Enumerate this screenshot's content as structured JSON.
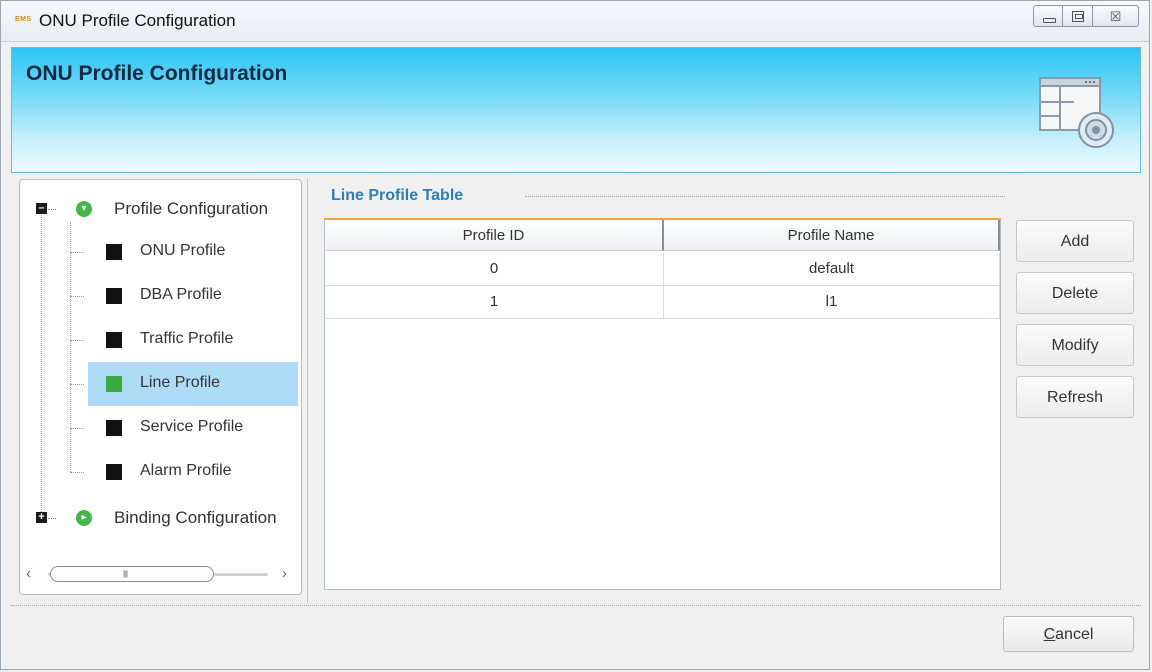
{
  "window": {
    "app_icon_text": "EMS",
    "title": "ONU Profile Configuration",
    "controls": {
      "minimize": "minimize",
      "maximize": "maximize",
      "close": "close"
    }
  },
  "banner": {
    "title": "ONU Profile Configuration"
  },
  "tree": {
    "groups": [
      {
        "label": "Profile Configuration",
        "expanded": true,
        "children": [
          {
            "label": "ONU Profile",
            "selected": false
          },
          {
            "label": "DBA Profile",
            "selected": false
          },
          {
            "label": "Traffic Profile",
            "selected": false
          },
          {
            "label": "Line Profile",
            "selected": true
          },
          {
            "label": "Service Profile",
            "selected": false
          },
          {
            "label": "Alarm Profile",
            "selected": false
          }
        ]
      },
      {
        "label": "Binding Configuration",
        "expanded": false
      }
    ]
  },
  "table": {
    "title": "Line Profile Table",
    "columns": [
      "Profile ID",
      "Profile Name"
    ],
    "rows": [
      [
        "0",
        "default"
      ],
      [
        "1",
        "l1"
      ]
    ]
  },
  "actions": {
    "add": "Add",
    "delete": "Delete",
    "modify": "Modify",
    "refresh": "Refresh"
  },
  "footer": {
    "cancel_prefix": "C",
    "cancel_rest": "ancel"
  },
  "colors": {
    "accent": "#2f7fb2",
    "selection": "#aedcf6",
    "table_top_border": "#f0a440",
    "node_green": "#3aab3f"
  }
}
